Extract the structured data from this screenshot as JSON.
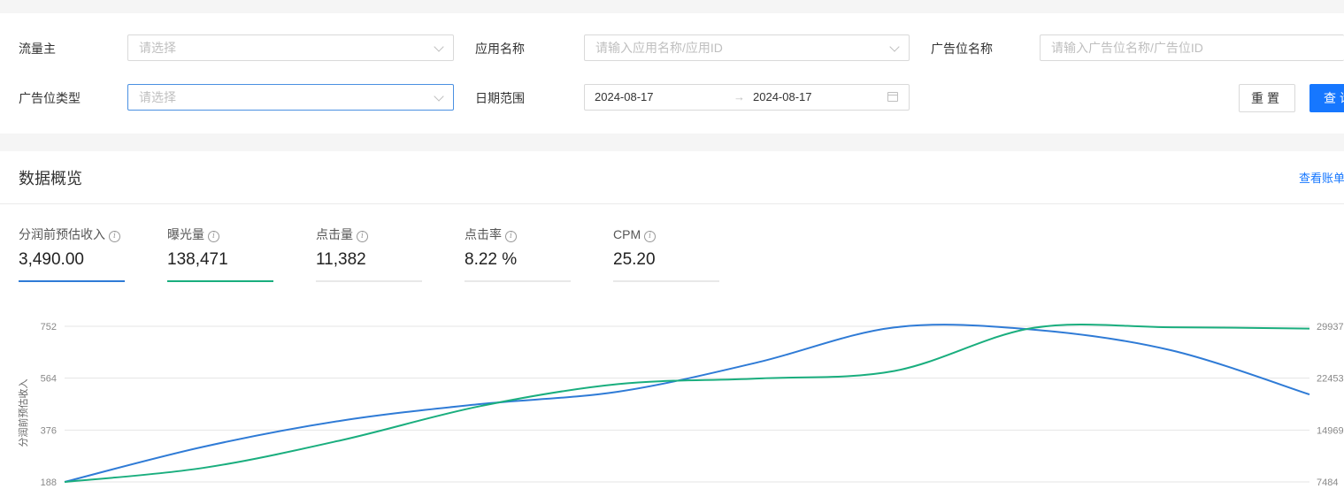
{
  "filters": {
    "traffic_owner": {
      "label": "流量主",
      "placeholder": "请选择"
    },
    "app_name": {
      "label": "应用名称",
      "placeholder": "请输入应用名称/应用ID"
    },
    "ad_slot_name": {
      "label": "广告位名称",
      "placeholder": "请输入广告位名称/广告位ID"
    },
    "ad_slot_type": {
      "label": "广告位类型",
      "placeholder": "请选择"
    },
    "date_range": {
      "label": "日期范围",
      "start": "2024-08-17",
      "separator": "→",
      "end": "2024-08-17"
    },
    "reset_label": "重置",
    "query_label": "查询"
  },
  "overview": {
    "title": "数据概览",
    "link_label": "查看账单",
    "metrics": [
      {
        "label": "分润前预估收入",
        "value": "3,490.00",
        "color": "#2f7bd6",
        "active": true
      },
      {
        "label": "曝光量",
        "value": "138,471",
        "color": "#1aae7e",
        "active": true
      },
      {
        "label": "点击量",
        "value": "11,382",
        "color": "#e8e8e8",
        "active": false
      },
      {
        "label": "点击率",
        "value": "8.22 %",
        "color": "#e8e8e8",
        "active": false
      },
      {
        "label": "CPM",
        "value": "25.20",
        "color": "#e8e8e8",
        "active": false
      }
    ]
  },
  "chart_data": {
    "type": "line",
    "ylabel": "分润前预估收入",
    "y_ticks_left": [
      "752",
      "564",
      "376",
      "188"
    ],
    "y_ticks_right": [
      "29937",
      "22453",
      "14969",
      "7484"
    ],
    "ylim_left": [
      188,
      752
    ],
    "ylim_right": [
      7484,
      29937
    ],
    "series": [
      {
        "color": "#2f7bd6",
        "axis": "left",
        "values": [
          188,
          315,
          410,
          470,
          515,
          620,
          748,
          740,
          665,
          505
        ]
      },
      {
        "color": "#1aae7e",
        "axis": "right",
        "values": [
          7484,
          9500,
          13500,
          18400,
          21600,
          22400,
          23500,
          29700,
          29800,
          29600
        ]
      }
    ]
  }
}
